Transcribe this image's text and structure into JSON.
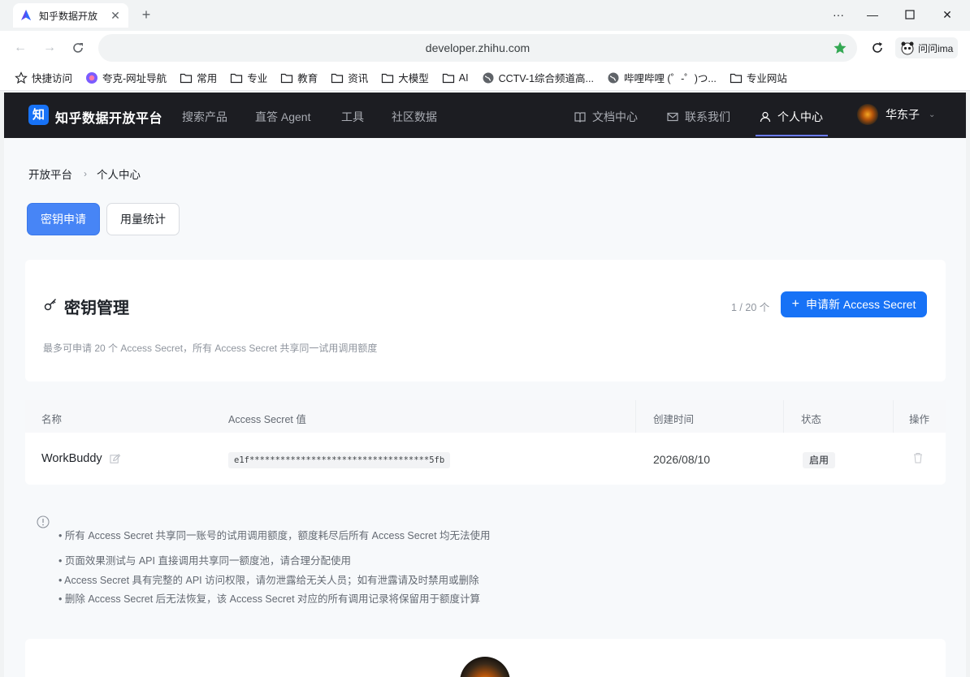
{
  "browser": {
    "tab_title": "知乎数据开放",
    "url": "developer.zhihu.com",
    "profile_label": "问问ima",
    "bookmarks": [
      {
        "label": "快捷访问",
        "icon": "star-outline-icon"
      },
      {
        "label": "夸克-网址导航",
        "icon": "quark-icon"
      },
      {
        "label": "常用",
        "icon": "folder-icon"
      },
      {
        "label": "专业",
        "icon": "folder-icon"
      },
      {
        "label": "教育",
        "icon": "folder-icon"
      },
      {
        "label": "资讯",
        "icon": "folder-icon"
      },
      {
        "label": "大模型",
        "icon": "folder-icon"
      },
      {
        "label": "AI",
        "icon": "folder-icon"
      },
      {
        "label": "CCTV-1综合频道高...",
        "icon": "globe-icon"
      },
      {
        "label": "哔哩哔哩 (゜-゜)つ...",
        "icon": "globe-icon"
      },
      {
        "label": "专业网站",
        "icon": "folder-icon"
      }
    ]
  },
  "header": {
    "logo_text": "知",
    "brand": "知乎数据开放平台",
    "nav": [
      "搜索产品",
      "直答 Agent",
      "工具",
      "社区数据"
    ],
    "docs": "文档中心",
    "contact": "联系我们",
    "personal": "个人中心",
    "user_name": "华东子"
  },
  "breadcrumb": {
    "root": "开放平台",
    "current": "个人中心"
  },
  "tabs": {
    "keys": "密钥申请",
    "usage": "用量统计"
  },
  "key_card": {
    "title": "密钥管理",
    "quota": "1 / 20 个",
    "apply_button": "申请新 Access Secret",
    "hint": "最多可申请 20 个 Access Secret，所有 Access Secret 共享同一试用调用额度"
  },
  "table": {
    "headers": {
      "name": "名称",
      "secret": "Access Secret 值",
      "created": "创建时间",
      "status": "状态",
      "actions": "操作"
    },
    "rows": [
      {
        "name": "WorkBuddy",
        "secret": "e1f***********************************5fb",
        "created": "2026/08/10",
        "status": "启用"
      }
    ]
  },
  "notice": [
    "• 所有 Access Secret 共享同一账号的试用调用额度，额度耗尽后所有 Access Secret 均无法使用",
    "• 页面效果测试与 API 直接调用共享同一额度池，请合理分配使用",
    "• Access Secret 具有完整的 API 访问权限，请勿泄露给无关人员；如有泄露请及时禁用或删除",
    "• 删除 Access Secret 后无法恢复，该 Access Secret 对应的所有调用记录将保留用于额度计算"
  ],
  "colors": {
    "primary": "#1772f6",
    "tab_active": "#4785f6",
    "header_bg": "#1c1d22",
    "nav_underline": "#6b7cff"
  }
}
